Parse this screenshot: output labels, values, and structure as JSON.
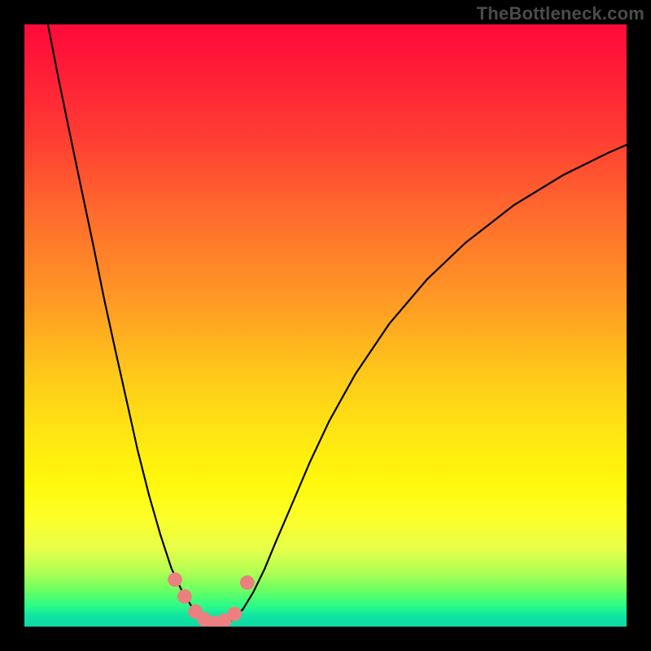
{
  "attribution": "TheBottleneck.com",
  "chart_data": {
    "type": "line",
    "title": "",
    "xlabel": "",
    "ylabel": "",
    "xlim": [
      0,
      100
    ],
    "ylim": [
      0,
      100
    ],
    "background_gradient_stops": [
      {
        "pos": 0,
        "color": "#ff0a3a"
      },
      {
        "pos": 0.06,
        "color": "#ff1838"
      },
      {
        "pos": 0.18,
        "color": "#ff3a33"
      },
      {
        "pos": 0.32,
        "color": "#ff6d2d"
      },
      {
        "pos": 0.46,
        "color": "#ff9a24"
      },
      {
        "pos": 0.58,
        "color": "#ffc81a"
      },
      {
        "pos": 0.68,
        "color": "#ffe612"
      },
      {
        "pos": 0.76,
        "color": "#fff80c"
      },
      {
        "pos": 0.82,
        "color": "#fcff28"
      },
      {
        "pos": 0.87,
        "color": "#e8ff4a"
      },
      {
        "pos": 0.91,
        "color": "#b0ff54"
      },
      {
        "pos": 0.94,
        "color": "#6aff62"
      },
      {
        "pos": 0.965,
        "color": "#2dfc87"
      },
      {
        "pos": 0.98,
        "color": "#11e7a0"
      },
      {
        "pos": 1.0,
        "color": "#0fd7a7"
      }
    ],
    "series": [
      {
        "name": "curve",
        "color": "#000000",
        "x": [
          3.9,
          5.7,
          7.6,
          9.5,
          11.4,
          13.2,
          15.1,
          17.0,
          18.8,
          20.7,
          22.6,
          24.4,
          26.3,
          28.2,
          31.9,
          33.8,
          36.3,
          38.0,
          39.9,
          41.8,
          44.3,
          47.4,
          50.6,
          55.0,
          60.6,
          66.9,
          73.2,
          81.3,
          89.5,
          97.0,
          100.0
        ],
        "y": [
          100.0,
          90.8,
          81.6,
          72.5,
          63.5,
          54.6,
          45.9,
          37.4,
          29.3,
          21.8,
          15.2,
          9.7,
          5.6,
          2.7,
          0.0,
          0.5,
          2.9,
          5.7,
          9.6,
          14.2,
          20.0,
          27.3,
          34.1,
          42.0,
          50.3,
          57.7,
          63.7,
          70.0,
          75.0,
          78.7,
          80.0
        ]
      }
    ],
    "highlight_points": {
      "color": "#ec8080",
      "radius_data_units": 1.2,
      "points": [
        {
          "x": 25.0,
          "y": 7.8
        },
        {
          "x": 26.6,
          "y": 5.0
        },
        {
          "x": 28.4,
          "y": 2.5
        },
        {
          "x": 29.9,
          "y": 1.2
        },
        {
          "x": 31.6,
          "y": 0.6
        },
        {
          "x": 33.2,
          "y": 1.0
        },
        {
          "x": 34.9,
          "y": 2.1
        },
        {
          "x": 37.0,
          "y": 7.3
        }
      ]
    }
  }
}
